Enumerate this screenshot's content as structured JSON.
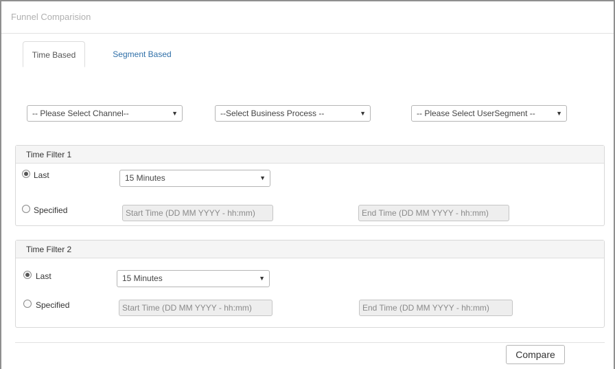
{
  "panel": {
    "title": "Funnel Comparision"
  },
  "tabs": [
    {
      "label": "Time Based",
      "active": true
    },
    {
      "label": "Segment Based",
      "active": false
    }
  ],
  "selectors": {
    "channel": "-- Please Select Channel--",
    "business_process": "--Select Business Process --",
    "user_segment": "-- Please Select UserSegment --"
  },
  "time_filter_1": {
    "title": "Time Filter 1",
    "last_label": "Last",
    "last_checked": true,
    "last_value": "15 Minutes",
    "specified_label": "Specified",
    "specified_checked": false,
    "start_placeholder": "Start Time (DD MM YYYY - hh:mm)",
    "end_placeholder": "End Time (DD MM YYYY - hh:mm)"
  },
  "time_filter_2": {
    "title": "Time Filter 2",
    "last_label": "Last",
    "last_checked": true,
    "last_value": "15 Minutes",
    "specified_label": "Specified",
    "specified_checked": false,
    "start_placeholder": "Start Time (DD MM YYYY - hh:mm)",
    "end_placeholder": "End Time (DD MM YYYY - hh:mm)"
  },
  "actions": {
    "compare_label": "Compare"
  },
  "icons": {
    "dropdown": "chevron-down-icon"
  }
}
